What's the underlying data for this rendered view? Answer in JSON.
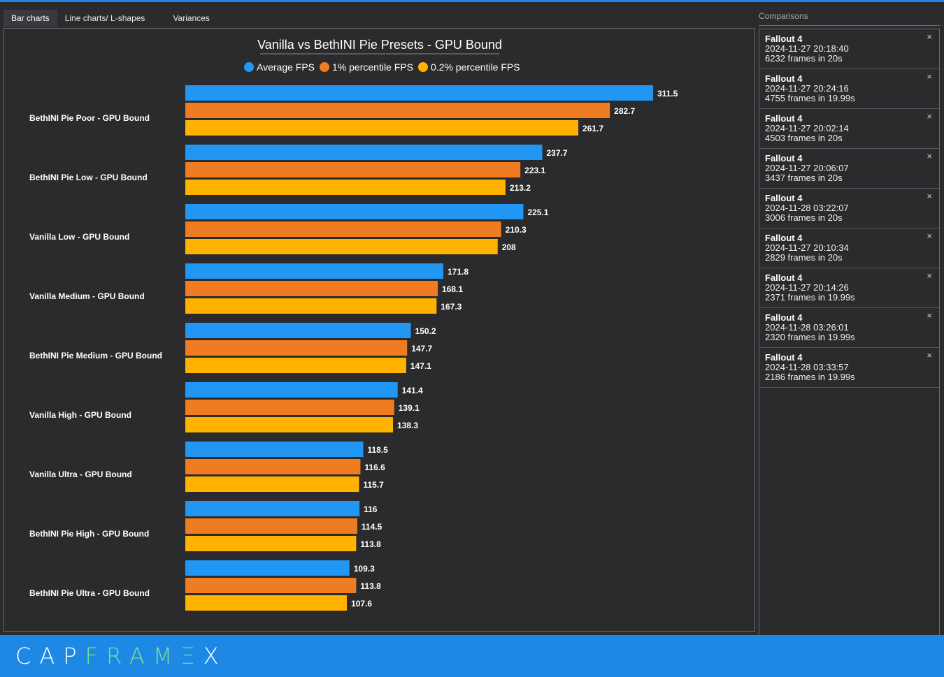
{
  "tabs": [
    "Bar charts",
    "Line charts/ L-shapes",
    "Variances"
  ],
  "active_tab": 0,
  "comparisons_header": "Comparisons",
  "comparisons": [
    {
      "game": "Fallout 4",
      "date": "2024-11-27 20:18:40",
      "frames": "6232 frames in 20s"
    },
    {
      "game": "Fallout 4",
      "date": "2024-11-27 20:24:16",
      "frames": "4755 frames in 19.99s"
    },
    {
      "game": "Fallout 4",
      "date": "2024-11-27 20:02:14",
      "frames": "4503 frames in 20s"
    },
    {
      "game": "Fallout 4",
      "date": "2024-11-27 20:06:07",
      "frames": "3437 frames in 20s"
    },
    {
      "game": "Fallout 4",
      "date": "2024-11-28 03:22:07",
      "frames": "3006 frames in 20s"
    },
    {
      "game": "Fallout 4",
      "date": "2024-11-27 20:10:34",
      "frames": "2829 frames in 20s"
    },
    {
      "game": "Fallout 4",
      "date": "2024-11-27 20:14:26",
      "frames": "2371 frames in 19.99s"
    },
    {
      "game": "Fallout 4",
      "date": "2024-11-28 03:26:01",
      "frames": "2320 frames in 19.99s"
    },
    {
      "game": "Fallout 4",
      "date": "2024-11-28 03:33:57",
      "frames": "2186 frames in 19.99s"
    }
  ],
  "close_glyph": "×",
  "logo": {
    "part1": "CAP",
    "part2": "FRAM",
    "part3": "Ξ",
    "part4": "X"
  },
  "colors": {
    "average": "#2196f3",
    "p1": "#f07c22",
    "p02": "#ffb300",
    "accent": "#1e88e5"
  },
  "chart_data": {
    "type": "bar",
    "orientation": "horizontal",
    "title": "Vanilla vs BethINI Pie Presets - GPU Bound",
    "legend_position": "top-center",
    "categories": [
      "BethINI Pie Poor - GPU Bound",
      "BethINI Pie Low - GPU Bound",
      "Vanilla Low - GPU Bound",
      "Vanilla Medium - GPU Bound",
      "BethINI Pie Medium - GPU Bound",
      "Vanilla High - GPU Bound",
      "Vanilla Ultra - GPU Bound",
      "BethINI Pie High - GPU Bound",
      "BethINI Pie Ultra - GPU Bound"
    ],
    "series": [
      {
        "name": "Average FPS",
        "values": [
          311.5,
          237.7,
          225.1,
          171.8,
          150.2,
          141.4,
          118.5,
          116,
          109.3
        ]
      },
      {
        "name": "1% percentile FPS",
        "values": [
          282.7,
          223.1,
          210.3,
          168.1,
          147.7,
          139.1,
          116.6,
          114.5,
          113.8
        ]
      },
      {
        "name": "0.2% percentile FPS",
        "values": [
          261.7,
          213.2,
          208,
          167.3,
          147.1,
          138.3,
          115.7,
          113.8,
          107.6
        ]
      }
    ],
    "xlim": [
      0,
      311.5
    ],
    "grid": false
  }
}
